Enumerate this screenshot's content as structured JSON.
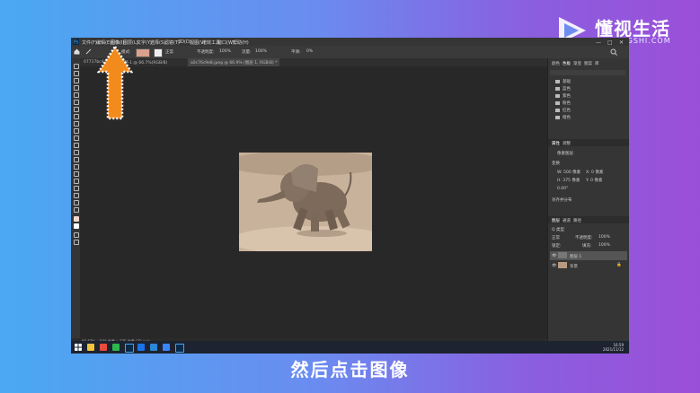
{
  "brand": {
    "name": "懂视生活",
    "sub": "51DONGSHI.COM"
  },
  "app": {
    "menu": [
      "文件(F)",
      "编辑(E)",
      "图像(I)",
      "图层(L)",
      "文字(Y)",
      "选择(S)",
      "滤镜(T)",
      "3D(D)",
      "视图(V)",
      "增效工具",
      "窗口(W)",
      "帮助(H)"
    ],
    "window_controls": [
      "—",
      "□",
      "✕"
    ],
    "options": {
      "mode_label": "模式:",
      "mode_value": "正常",
      "opacity_label": "不透明度:",
      "opacity_value": "100%",
      "flow_label": "流量:",
      "flow_value": "100%",
      "smooth_label": "平滑:",
      "smooth_value": "0%"
    },
    "tabs": [
      "07717bc4d...",
      "未标题-1 @ 66.7%(RGB/8)",
      "a0c76c9e8.jpeg @ 66.9% (图层 1, RGB/8) *"
    ],
    "status_left": "66.67%",
    "status_mid": "500 像素 x 375 像素 (72 ppi)",
    "panels": {
      "top_tabs": [
        "颜色",
        "色板",
        "渐变",
        "图案",
        "库"
      ],
      "swatch_folders": [
        "基础",
        "蓝色",
        "紫色",
        "粉色",
        "红色",
        "橙色"
      ],
      "props_tabs": [
        "属性",
        "调整"
      ],
      "props_title": "像素图层",
      "transform_label": "变换",
      "w_label": "W: 500 像素",
      "x_label": "X: 0 像素",
      "h_label": "H: 375 像素",
      "y_label": "Y: 0 像素",
      "angle_label": "0.00°",
      "align_label": "对齐并分布",
      "layers_tabs": [
        "图层",
        "通道",
        "路径"
      ],
      "kind_label": "Q 类型",
      "blend_mode": "正常",
      "opacity_label": "不透明度:",
      "opacity_value": "100%",
      "lock_label": "锁定:",
      "fill_label": "填充:",
      "fill_value": "100%",
      "layers": [
        "图层 1",
        "背景"
      ]
    },
    "clock_time": "16:59",
    "clock_date": "2021/11/12"
  },
  "caption": "然后点击图像",
  "colors": {
    "arrow": "#f28a1c",
    "accent": "#2b6cb0"
  }
}
